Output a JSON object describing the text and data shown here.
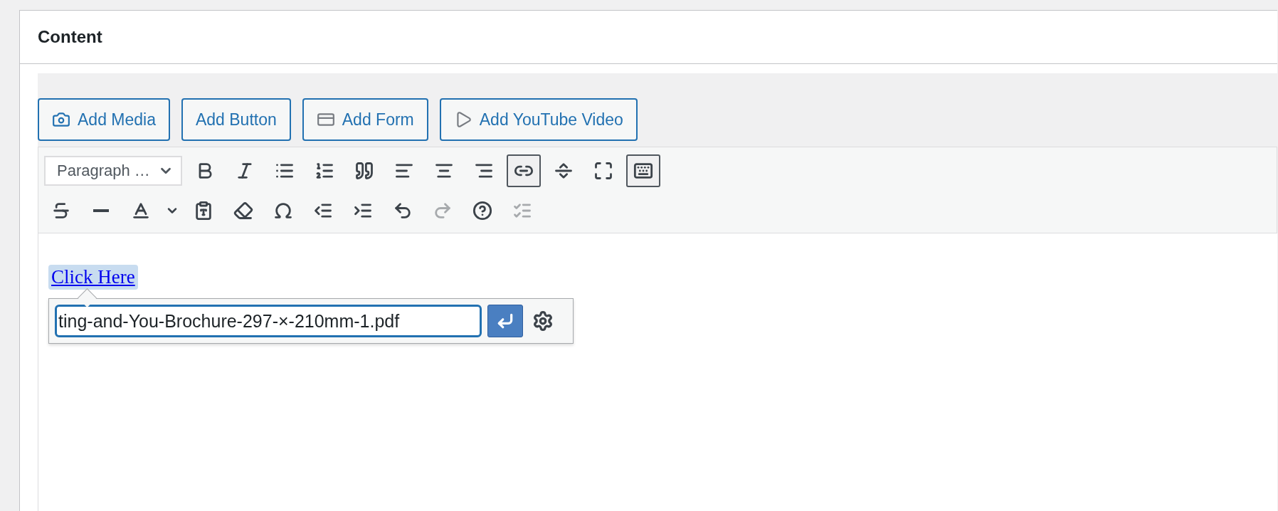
{
  "panel": {
    "title": "Content"
  },
  "media_buttons": [
    {
      "label": "Add Media"
    },
    {
      "label": "Add Button"
    },
    {
      "label": "Add Form"
    },
    {
      "label": "Add YouTube Video"
    }
  ],
  "format_select": {
    "value": "Paragraph …"
  },
  "toolbar_row_1": [
    {
      "pressed": false,
      "disabled": false
    },
    {
      "pressed": false,
      "disabled": false
    },
    {
      "pressed": false,
      "disabled": false
    },
    {
      "pressed": false,
      "disabled": false
    },
    {
      "pressed": false,
      "disabled": false
    },
    {
      "pressed": false,
      "disabled": false
    },
    {
      "pressed": false,
      "disabled": false
    },
    {
      "pressed": false,
      "disabled": false
    },
    {
      "pressed": true,
      "disabled": false
    },
    {
      "pressed": false,
      "disabled": false
    },
    {
      "pressed": false,
      "disabled": false
    },
    {
      "pressed": true,
      "disabled": false
    }
  ],
  "toolbar_row_2": [
    {
      "pressed": false,
      "disabled": false
    },
    {
      "pressed": false,
      "disabled": false
    },
    {
      "pressed": false,
      "disabled": false
    },
    {
      "pressed": false,
      "disabled": false
    },
    {
      "pressed": false,
      "disabled": false
    },
    {
      "pressed": false,
      "disabled": false
    },
    {
      "pressed": false,
      "disabled": false
    },
    {
      "pressed": false,
      "disabled": false
    },
    {
      "pressed": false,
      "disabled": false
    },
    {
      "pressed": false,
      "disabled": true
    },
    {
      "pressed": false,
      "disabled": false
    },
    {
      "pressed": false,
      "disabled": true
    }
  ],
  "editor": {
    "link_text": "Click Here",
    "link_selected": true
  },
  "link_popup": {
    "url": "ting-and-You-Brochure-297-×-210mm-1.pdf"
  }
}
